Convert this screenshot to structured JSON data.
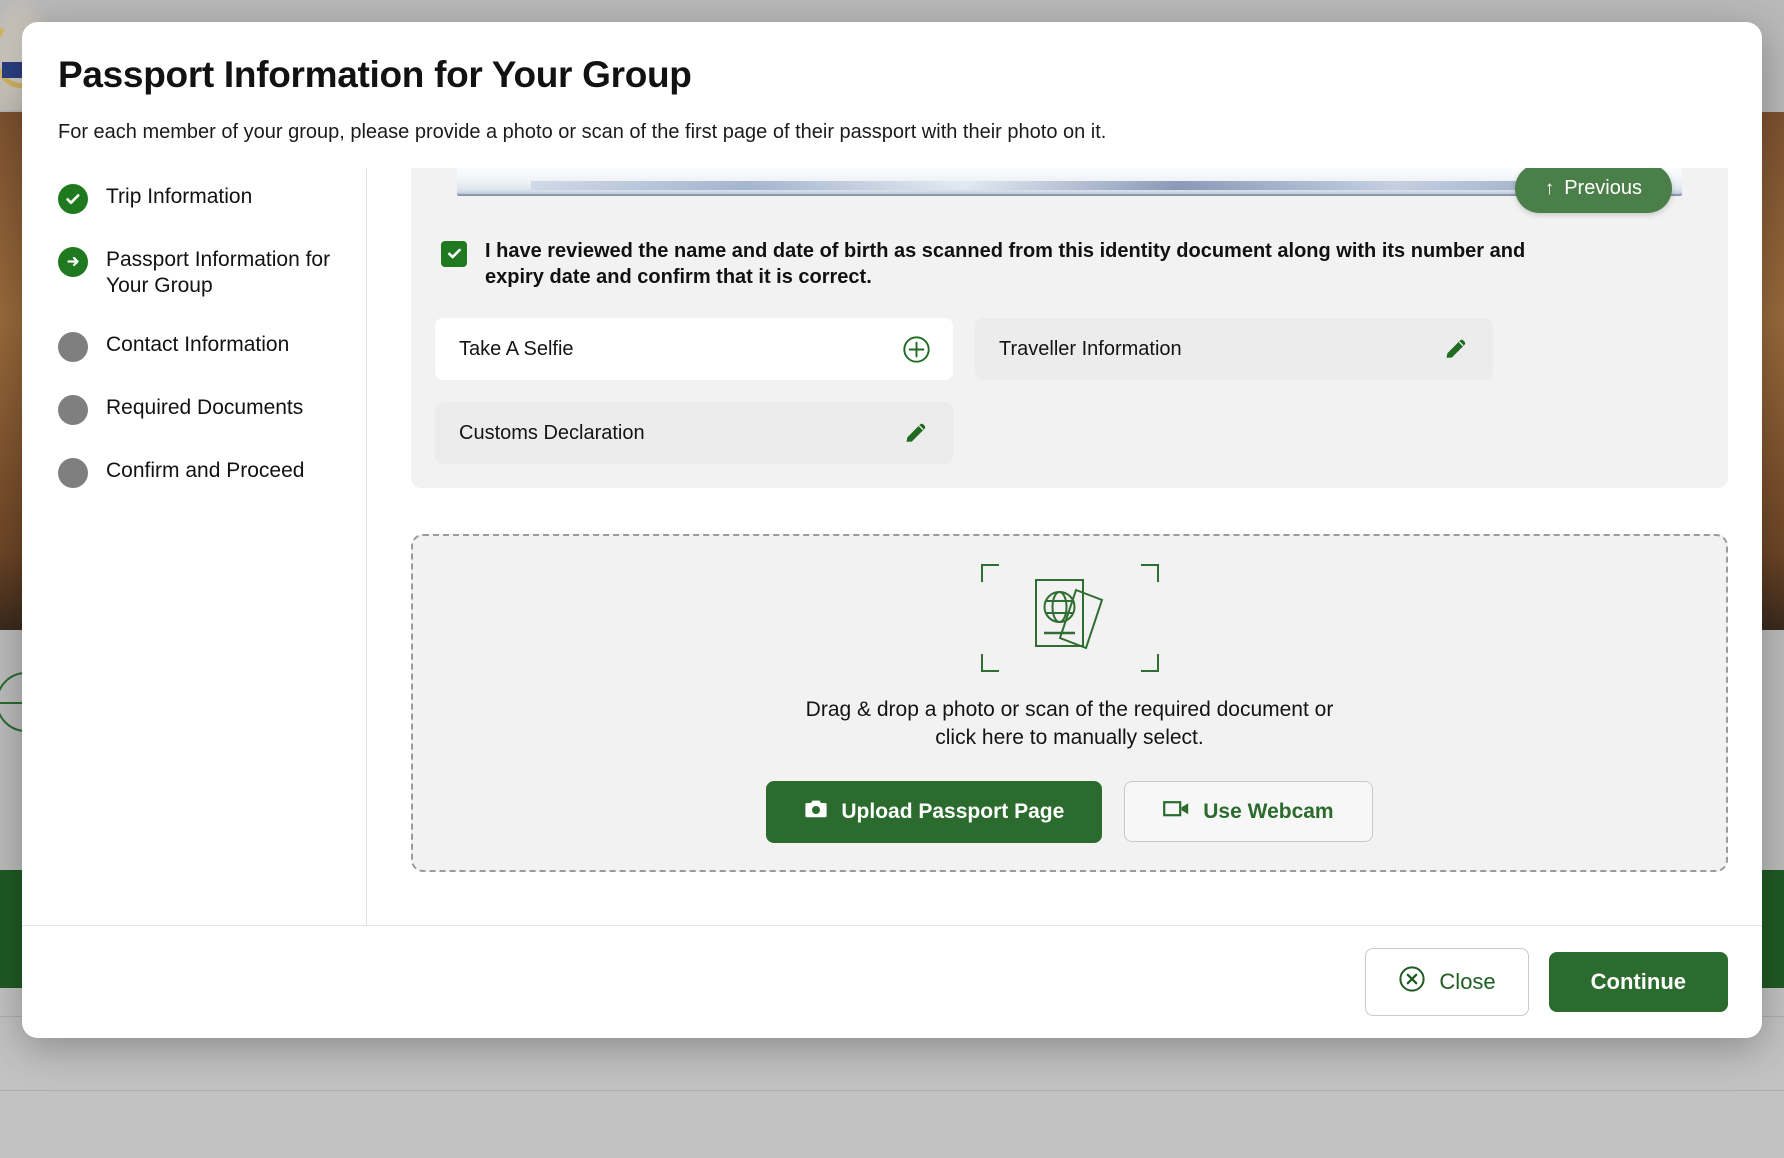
{
  "modal": {
    "title": "Passport Information for Your Group",
    "subtitle": "For each member of your group, please provide a photo or scan of the first page of their passport with their photo on it."
  },
  "stepper": {
    "items": [
      {
        "label": "Trip Information",
        "state": "done",
        "icon": "check-icon"
      },
      {
        "label": "Passport Information for Your Group",
        "state": "current",
        "icon": "arrow-right-icon"
      },
      {
        "label": "Contact Information",
        "state": "pending",
        "icon": "dot-icon"
      },
      {
        "label": "Required Documents",
        "state": "pending",
        "icon": "dot-icon"
      },
      {
        "label": "Confirm and Proceed",
        "state": "pending",
        "icon": "dot-icon"
      }
    ]
  },
  "review": {
    "previous_label": "Previous",
    "previous_icon": "arrow-up-icon",
    "confirm_text": "I have reviewed the name and date of birth as scanned from this identity document along with its number and expiry date and confirm that it is correct.",
    "checkbox_checked": true,
    "tiles": [
      {
        "label": "Take A Selfie",
        "icon": "plus-circle-icon",
        "style": "light"
      },
      {
        "label": "Traveller Information",
        "icon": "pencil-icon",
        "style": "muted"
      },
      {
        "label": "Customs Declaration",
        "icon": "pencil-icon",
        "style": "muted"
      }
    ]
  },
  "dropzone": {
    "icon": "passport-globe-icon",
    "text_line1": "Drag & drop a photo or scan of the required document or",
    "text_line2": "click here to manually select.",
    "upload_label": "Upload Passport Page",
    "upload_icon": "camera-icon",
    "webcam_label": "Use Webcam",
    "webcam_icon": "video-camera-icon"
  },
  "footer": {
    "close_label": "Close",
    "close_icon": "close-circle-icon",
    "continue_label": "Continue"
  },
  "colors": {
    "brand_green": "#2b6b2e",
    "step_done_green": "#1f7a1f",
    "previous_green": "#4a7f4a",
    "pending_grey": "#7f7f7f"
  }
}
